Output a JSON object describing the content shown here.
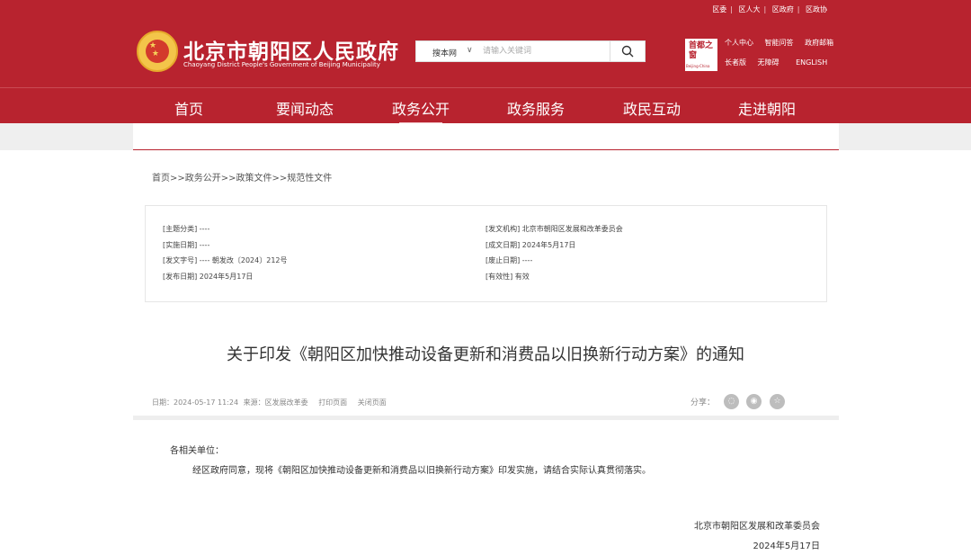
{
  "header": {
    "top_links": [
      "区委",
      "区人大",
      "区政府",
      "区政协"
    ],
    "site_title": "北京市朝阳区人民政府",
    "site_subtitle": "Chaoyang District People's Government of Beijing Municipality",
    "search": {
      "scope": "搜本网",
      "placeholder": "请输入关键词"
    },
    "seal": {
      "text": "首都之窗",
      "foot": "Beijing-China"
    },
    "quick_links_row1": [
      "个人中心",
      "智能问答",
      "政府邮箱"
    ],
    "quick_links_row2": [
      "长者版",
      "无障碍",
      "ENGLISH"
    ]
  },
  "nav": {
    "items": [
      "首页",
      "要闻动态",
      "政务公开",
      "政务服务",
      "政民互动",
      "走进朝阳"
    ],
    "active": "政务公开"
  },
  "breadcrumb": "首页>>政务公开>>政策文件>>规范性文件",
  "meta": {
    "left": [
      "[主题分类] ----",
      "[实施日期] ----",
      "[发文字号] ---- 朝发改〔2024〕212号",
      "[发布日期] 2024年5月17日"
    ],
    "right": [
      "[发文机构] 北京市朝阳区发展和改革委员会",
      "[成文日期] 2024年5月17日",
      "[废止日期] ----",
      "[有效性] 有效"
    ]
  },
  "document": {
    "title": "关于印发《朝阳区加快推动设备更新和消费品以旧换新行动方案》的通知",
    "info": {
      "date": "日期：2024-05-17 11:24",
      "source": "来源：区发展改革委",
      "print": "打印页面",
      "close": "关闭页面"
    },
    "share_label": "分享：",
    "share_icons": [
      "wechat-icon",
      "weibo-icon",
      "favorite-icon"
    ],
    "salutation": "各相关单位：",
    "paragraph": "经区政府同意，现将《朝阳区加快推动设备更新和消费品以旧换新行动方案》印发实施，请结合实际认真贯彻落实。",
    "signature_org": "北京市朝阳区发展和改革委员会",
    "signature_date": "2024年5月17日"
  },
  "colors": {
    "brand_red": "#b8232f",
    "gold": "#f3c54a"
  }
}
